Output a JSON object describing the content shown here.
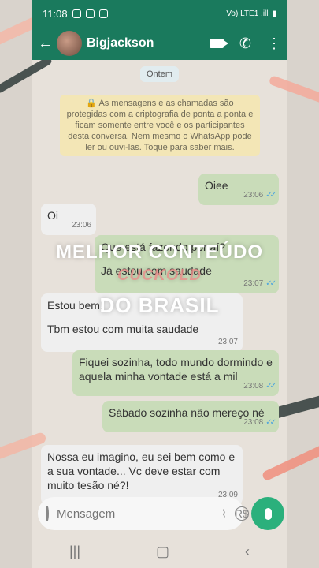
{
  "status_bar": {
    "time": "11:08",
    "network": "Vo) LTE1 .ill"
  },
  "header": {
    "contact_name": "Bigjackson"
  },
  "chat": {
    "date_chip": "Ontem",
    "encryption_notice": "🔒 As mensagens e as chamadas são protegidas com a criptografia de ponta a ponta e ficam somente entre você e os participantes desta conversa. Nem mesmo o WhatsApp pode ler ou ouvi-las. Toque para saber mais.",
    "messages": [
      {
        "text": "Oiee",
        "time": "23:06"
      },
      {
        "text": "Oi",
        "time": "23:06"
      },
      {
        "text": "Que está fazendo por aí?",
        "time": ""
      },
      {
        "text": "Já estou com saudade",
        "time": "23:07"
      },
      {
        "text": "Estou bem!",
        "time": ""
      },
      {
        "text": "Tbm estou com muita saudade",
        "time": "23:07"
      },
      {
        "text": "Fiquei sozinha, todo mundo dormindo e aquela minha vontade está a mil",
        "time": "23:08"
      },
      {
        "text": "Sábado sozinha não mereço né",
        "time": "23:08"
      },
      {
        "text": "Nossa eu imagino, eu sei bem como e a sua vontade... Vc deve estar com muito tesão né?!",
        "time": "23:09"
      }
    ]
  },
  "overlay": {
    "line1": "MELHOR CONTEÚDO",
    "line2": "CUCKOLD",
    "line3": "DO BRASIL"
  },
  "composer": {
    "placeholder": "Mensagem",
    "currency_label": "R$"
  },
  "colors": {
    "header": "#1a7a5d",
    "outgoing": "#c9dcb9",
    "incoming": "#efefef",
    "mic": "#2bb07c"
  }
}
